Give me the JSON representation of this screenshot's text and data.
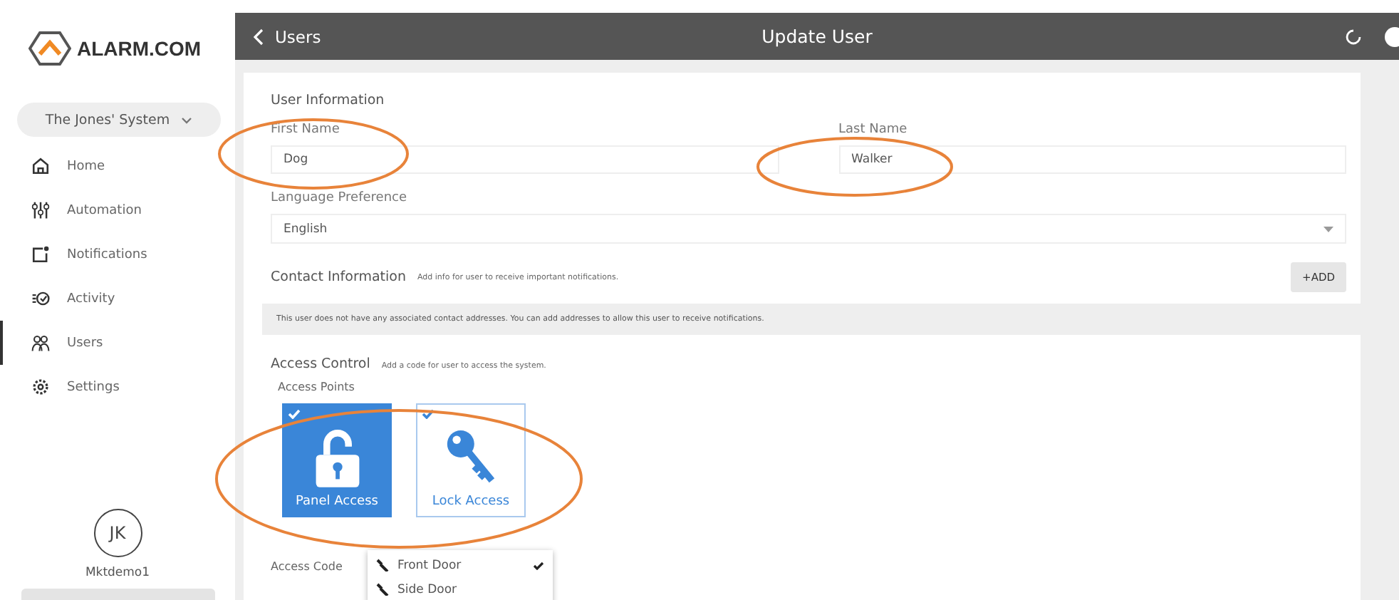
{
  "sidebar": {
    "logo": "ALARM.COM",
    "system_selector": "The Jones' System",
    "items": [
      {
        "label": "Home",
        "selected": false
      },
      {
        "label": "Automation",
        "selected": false
      },
      {
        "label": "Notifications",
        "selected": false
      },
      {
        "label": "Activity",
        "selected": false
      },
      {
        "label": "Users",
        "selected": true
      },
      {
        "label": "Settings",
        "selected": false
      }
    ],
    "user": {
      "initials": "JK",
      "name": "Mktdemo1"
    }
  },
  "header": {
    "back": "Users",
    "title": "Update User"
  },
  "user_information": {
    "heading": "User Information",
    "first_name": {
      "label": "First Name",
      "value": "Dog"
    },
    "last_name": {
      "label": "Last Name",
      "value": "Walker"
    },
    "language": {
      "label": "Language Preference",
      "value": "English"
    }
  },
  "contact_information": {
    "heading": "Contact Information",
    "hint": "Add info for user to receive important notifications.",
    "add_button": "+ADD",
    "notice": "This user does not have any associated contact addresses. You can add addresses to allow this user to receive notifications."
  },
  "access_control": {
    "heading": "Access Control",
    "hint": "Add a code for user to access the system.",
    "access_points_label": "Access Points",
    "access_points": [
      {
        "label": "Panel Access",
        "kind": "panel",
        "checked": true,
        "selected": true
      },
      {
        "label": "Lock Access",
        "kind": "lock",
        "checked": true,
        "selected": false
      }
    ],
    "locks": [
      {
        "label": "Front Door",
        "checked": true
      },
      {
        "label": "Side Door",
        "checked": false
      }
    ],
    "access_code_label": "Access Code"
  }
}
